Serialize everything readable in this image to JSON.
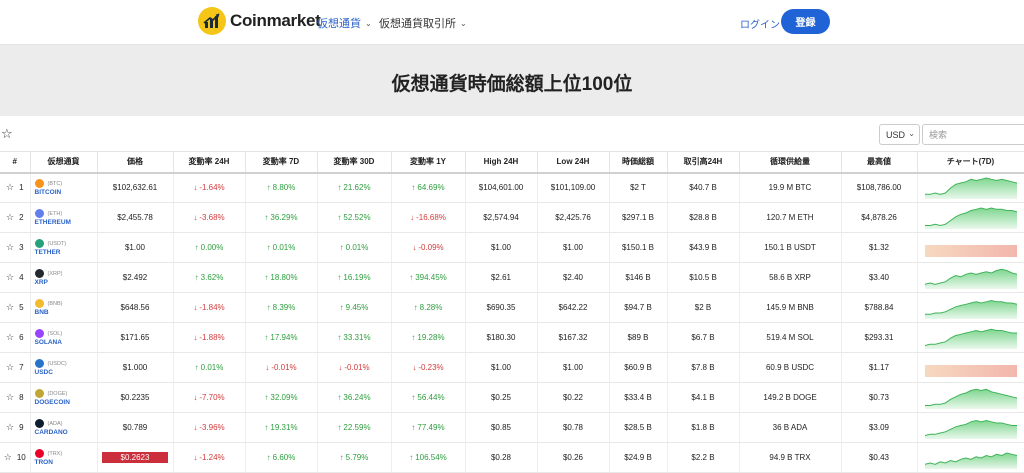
{
  "brand": {
    "name": "Coinmarket"
  },
  "nav": [
    {
      "label": "仮想通貨"
    },
    {
      "label": "仮想通貨取引所"
    }
  ],
  "auth": {
    "login": "ログイン",
    "register": "登録"
  },
  "hero": {
    "title": "仮想通貨時価総額上位100位"
  },
  "controls": {
    "currency": "USD",
    "search_placeholder": "検索"
  },
  "table": {
    "headers": [
      "#",
      "仮想通貨",
      "価格",
      "変動率 24H",
      "変動率 7D",
      "変動率 30D",
      "変動率 1Y",
      "High 24H",
      "Low 24H",
      "時価総額",
      "取引高24H",
      "循環供給量",
      "最高値",
      "チャート(7D)"
    ],
    "rows": [
      {
        "rank": "1",
        "symbol": "(BTC)",
        "name": "BITCOIN",
        "icon_color": "#f7931a",
        "price": "$102,632.61",
        "c24h": "-1.64%",
        "c7d": "8.80%",
        "c30d": "21.62%",
        "c1y": "64.69%",
        "high": "$104,601.00",
        "low": "$101,109.00",
        "mcap": "$2 T",
        "vol": "$40.7 B",
        "supply": "19.9 M BTC",
        "ath": "$108,786.00",
        "chart_trend": "up",
        "chart": [
          3,
          3,
          4,
          3,
          4,
          8,
          11,
          12,
          13,
          15,
          14,
          15,
          16,
          15,
          14,
          15,
          14,
          13,
          12
        ]
      },
      {
        "rank": "2",
        "symbol": "(ETH)",
        "name": "ETHEREUM",
        "icon_color": "#627eea",
        "price": "$2,455.78",
        "c24h": "-3.68%",
        "c7d": "36.29%",
        "c30d": "52.52%",
        "c1y": "-16.68%",
        "high": "$2,574.94",
        "low": "$2,425.76",
        "mcap": "$297.1 B",
        "vol": "$28.8 B",
        "supply": "120.7 M ETH",
        "ath": "$4,878.26",
        "chart_trend": "up",
        "chart": [
          2,
          2,
          3,
          2,
          3,
          6,
          9,
          11,
          12,
          14,
          15,
          16,
          15,
          16,
          15,
          15,
          14,
          14,
          13
        ]
      },
      {
        "rank": "3",
        "symbol": "(USDT)",
        "name": "TETHER",
        "icon_color": "#26a17b",
        "price": "$1.00",
        "c24h": "0.00%",
        "c7d": "0.01%",
        "c30d": "0.01%",
        "c1y": "-0.09%",
        "high": "$1.00",
        "low": "$1.00",
        "mcap": "$150.1 B",
        "vol": "$43.9 B",
        "supply": "150.1 B USDT",
        "ath": "$1.32",
        "chart_trend": "down",
        "chart": [
          8,
          8,
          8,
          8,
          8,
          8,
          8,
          8,
          8,
          8,
          8,
          8,
          8,
          8,
          8,
          8,
          8,
          8,
          8
        ]
      },
      {
        "rank": "4",
        "symbol": "(XRP)",
        "name": "XRP",
        "icon_color": "#23292f",
        "price": "$2.492",
        "c24h": "3.62%",
        "c7d": "18.80%",
        "c30d": "16.19%",
        "c1y": "394.45%",
        "high": "$2.61",
        "low": "$2.40",
        "mcap": "$146 B",
        "vol": "$10.5 B",
        "supply": "58.6 B XRP",
        "ath": "$3.40",
        "chart_trend": "up",
        "chart": [
          3,
          4,
          3,
          4,
          5,
          8,
          10,
          9,
          11,
          12,
          11,
          12,
          13,
          12,
          14,
          15,
          14,
          12,
          11
        ]
      },
      {
        "rank": "5",
        "symbol": "(BNB)",
        "name": "BNB",
        "icon_color": "#f3ba2f",
        "price": "$648.56",
        "c24h": "-1.84%",
        "c7d": "8.39%",
        "c30d": "9.45%",
        "c1y": "8.28%",
        "high": "$690.35",
        "low": "$642.22",
        "mcap": "$94.7 B",
        "vol": "$2 B",
        "supply": "145.9 M BNB",
        "ath": "$788.84",
        "chart_trend": "up",
        "chart": [
          3,
          3,
          4,
          4,
          5,
          7,
          9,
          10,
          11,
          12,
          13,
          12,
          13,
          14,
          13,
          13,
          12,
          12,
          11
        ]
      },
      {
        "rank": "6",
        "symbol": "(SOL)",
        "name": "SOLANA",
        "icon_color": "#9945ff",
        "price": "$171.65",
        "c24h": "-1.88%",
        "c7d": "17.94%",
        "c30d": "33.31%",
        "c1y": "19.28%",
        "high": "$180.30",
        "low": "$167.32",
        "mcap": "$89 B",
        "vol": "$6.7 B",
        "supply": "519.4 M SOL",
        "ath": "$293.31",
        "chart_trend": "up",
        "chart": [
          2,
          3,
          3,
          4,
          5,
          8,
          10,
          11,
          12,
          13,
          14,
          13,
          14,
          15,
          14,
          14,
          13,
          12,
          12
        ]
      },
      {
        "rank": "7",
        "symbol": "(USDC)",
        "name": "USDC",
        "icon_color": "#2775ca",
        "price": "$1.000",
        "c24h": "0.01%",
        "c7d": "-0.01%",
        "c30d": "-0.01%",
        "c1y": "-0.23%",
        "high": "$1.00",
        "low": "$1.00",
        "mcap": "$60.9 B",
        "vol": "$7.8 B",
        "supply": "60.9 B USDC",
        "ath": "$1.17",
        "chart_trend": "down",
        "chart": [
          8,
          8,
          8,
          8,
          8,
          8,
          8,
          8,
          8,
          8,
          8,
          8,
          8,
          8,
          8,
          8,
          8,
          8,
          8
        ]
      },
      {
        "rank": "8",
        "symbol": "(DOGE)",
        "name": "DOGECOIN",
        "icon_color": "#c2a633",
        "price": "$0.2235",
        "c24h": "-7.70%",
        "c7d": "32.09%",
        "c30d": "36.24%",
        "c1y": "56.44%",
        "high": "$0.25",
        "low": "$0.22",
        "mcap": "$33.4 B",
        "vol": "$4.1 B",
        "supply": "149.2 B DOGE",
        "ath": "$0.73",
        "chart_trend": "up",
        "chart": [
          2,
          2,
          3,
          3,
          4,
          7,
          9,
          11,
          12,
          14,
          15,
          14,
          15,
          13,
          12,
          11,
          10,
          9,
          8
        ]
      },
      {
        "rank": "9",
        "symbol": "(ADA)",
        "name": "CARDANO",
        "icon_color": "#0d1e30",
        "price": "$0.789",
        "c24h": "-3.96%",
        "c7d": "19.31%",
        "c30d": "22.59%",
        "c1y": "77.49%",
        "high": "$0.85",
        "low": "$0.78",
        "mcap": "$28.5 B",
        "vol": "$1.8 B",
        "supply": "36 B ADA",
        "ath": "$3.09",
        "chart_trend": "up",
        "chart": [
          2,
          3,
          3,
          4,
          5,
          7,
          9,
          10,
          11,
          13,
          14,
          13,
          14,
          13,
          12,
          12,
          11,
          10,
          10
        ]
      },
      {
        "rank": "10",
        "symbol": "(TRX)",
        "name": "TRON",
        "icon_color": "#eb0029",
        "price": "$0.2623",
        "price_highlight": true,
        "c24h": "-1.24%",
        "c7d": "6.60%",
        "c30d": "5.79%",
        "c1y": "106.54%",
        "high": "$0.28",
        "low": "$0.26",
        "mcap": "$24.9 B",
        "vol": "$2.2 B",
        "supply": "94.9 B TRX",
        "ath": "$0.43",
        "chart_trend": "up",
        "chart": [
          3,
          4,
          3,
          5,
          4,
          6,
          5,
          7,
          8,
          7,
          9,
          8,
          10,
          9,
          11,
          10,
          12,
          11,
          10
        ]
      }
    ]
  },
  "colors": {
    "accent": "#1f63d6",
    "up": "#2e9e3e",
    "down": "#d33b3b",
    "highlight": "#cc2f3c",
    "logo": "#f5c518"
  },
  "icons": {
    "logo": "chart-arrow-icon",
    "favorite": "star-outline-icon",
    "dropdown": "chevron-down-icon"
  }
}
